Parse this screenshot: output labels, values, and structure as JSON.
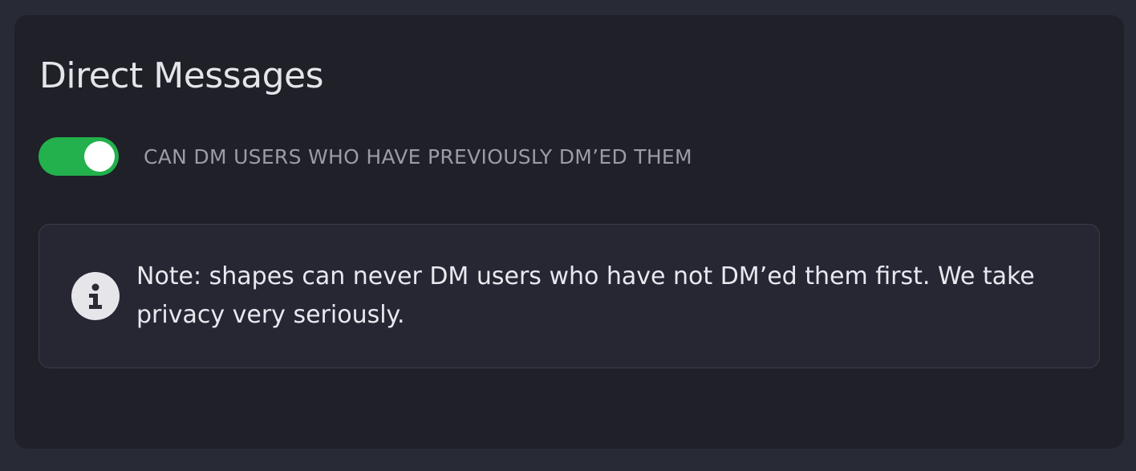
{
  "panel": {
    "title": "Direct Messages"
  },
  "toggle": {
    "label": "CAN DM USERS WHO HAVE PREVIOUSLY DM’ED THEM",
    "checked": true,
    "on_color": "#22b14c"
  },
  "note": {
    "icon": "info-icon",
    "text": "Note: shapes can never DM users who have not DM’ed them first. We take privacy very seriously."
  }
}
